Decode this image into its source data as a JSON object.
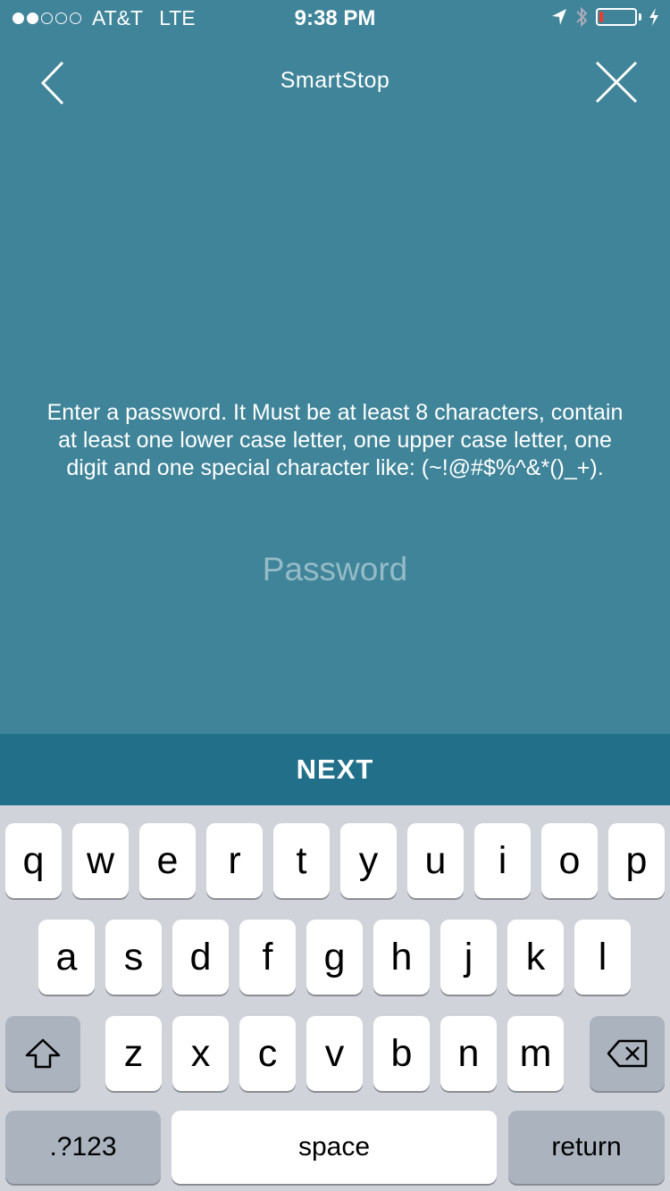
{
  "status_bar": {
    "carrier": "AT&T",
    "network": "LTE",
    "time": "9:38 PM",
    "signal_bars_filled": 2,
    "signal_bars_total": 5,
    "battery_level": 0.1,
    "icons": [
      "location-arrow-icon",
      "bluetooth-icon",
      "battery-icon",
      "charging-bolt-icon"
    ]
  },
  "nav": {
    "title": "SmartStop",
    "back_icon": "chevron-left-icon",
    "close_icon": "close-icon"
  },
  "form": {
    "instructions": "Enter a password. It Must be at least 8 characters, contain at least one lower case letter, one upper case letter, one digit and one special character like: (~!@#$%^&*()_+).",
    "password_placeholder": "Password",
    "password_value": ""
  },
  "next_label": "NEXT",
  "keyboard": {
    "row1": [
      "q",
      "w",
      "e",
      "r",
      "t",
      "y",
      "u",
      "i",
      "o",
      "p"
    ],
    "row2": [
      "a",
      "s",
      "d",
      "f",
      "g",
      "h",
      "j",
      "k",
      "l"
    ],
    "row3": [
      "z",
      "x",
      "c",
      "v",
      "b",
      "n",
      "m"
    ],
    "numbers_label": ".?123",
    "space_label": "space",
    "return_label": "return",
    "shift_icon": "shift-icon",
    "backspace_icon": "backspace-icon"
  },
  "colors": {
    "background": "#3f8499",
    "next_bar": "#216f89",
    "keyboard_bg": "#d0d4da",
    "func_key": "#aab3be",
    "battery_low": "#f03a2a"
  }
}
